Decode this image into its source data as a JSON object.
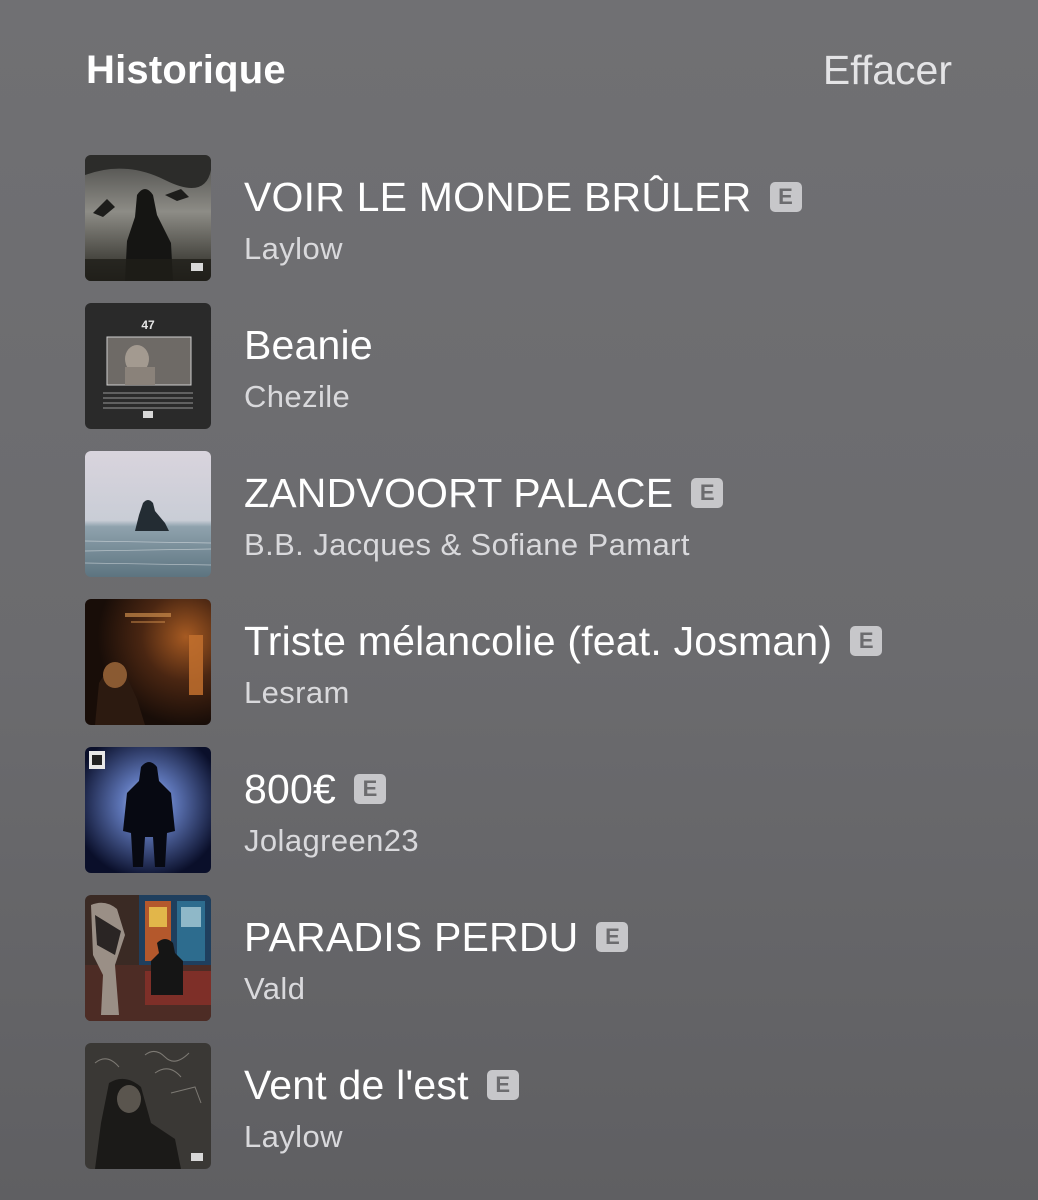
{
  "header": {
    "title": "Historique",
    "clear_label": "Effacer"
  },
  "explicit_badge": "E",
  "tracks": [
    {
      "title": "VOIR LE MONDE BRÛLER",
      "artist": "Laylow",
      "explicit": true,
      "artwork": "dark-storm-figure-artwork"
    },
    {
      "title": "Beanie",
      "artist": "Chezile",
      "explicit": false,
      "artwork": "47-album-artwork"
    },
    {
      "title": "ZANDVOORT PALACE",
      "artist": "B.B. Jacques & Sofiane Pamart",
      "explicit": true,
      "artwork": "sea-swimmer-artwork"
    },
    {
      "title": "Triste mélancolie (feat. Josman)",
      "artist": "Lesram",
      "explicit": true,
      "artwork": "dark-room-artwork"
    },
    {
      "title": "800€",
      "artist": "Jolagreen23",
      "explicit": true,
      "artwork": "silhouette-artwork"
    },
    {
      "title": "PARADIS PERDU",
      "artist": "Vald",
      "explicit": true,
      "artwork": "church-scene-artwork"
    },
    {
      "title": "Vent de l'est",
      "artist": "Laylow",
      "explicit": true,
      "artwork": "graffiti-wall-artwork"
    }
  ]
}
